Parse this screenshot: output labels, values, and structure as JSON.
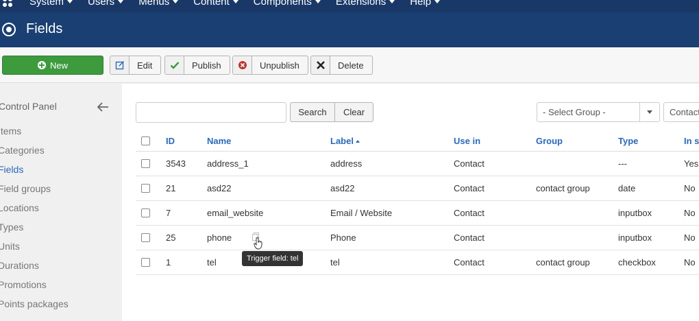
{
  "topnav": {
    "items": [
      {
        "label": "System"
      },
      {
        "label": "Users"
      },
      {
        "label": "Menus"
      },
      {
        "label": "Content"
      },
      {
        "label": "Components"
      },
      {
        "label": "Extensions"
      },
      {
        "label": "Help"
      }
    ]
  },
  "header": {
    "title": "Fields"
  },
  "toolbar": {
    "new_label": "New",
    "edit_label": "Edit",
    "publish_label": "Publish",
    "unpublish_label": "Unpublish",
    "delete_label": "Delete"
  },
  "sidebar": {
    "control_panel": "Control Panel",
    "items": [
      {
        "label": "Items",
        "active": false
      },
      {
        "label": "Categories",
        "active": false
      },
      {
        "label": "Fields",
        "active": true
      },
      {
        "label": "Field groups",
        "active": false
      },
      {
        "label": "Locations",
        "active": false
      },
      {
        "label": "Types",
        "active": false
      },
      {
        "label": "Units",
        "active": false
      },
      {
        "label": "Durations",
        "active": false
      },
      {
        "label": "Promotions",
        "active": false
      },
      {
        "label": "Points packages",
        "active": false
      }
    ]
  },
  "filters": {
    "search_value": "",
    "search_label": "Search",
    "clear_label": "Clear",
    "group_select": "- Select Group -",
    "context_select": "Contact"
  },
  "table": {
    "headers": {
      "id": "ID",
      "name": "Name",
      "label": "Label",
      "use_in": "Use in",
      "group": "Group",
      "type": "Type",
      "in_s": "In s"
    },
    "rows": [
      {
        "id": "3543",
        "name": "address_1",
        "label": "address",
        "use_in": "Contact",
        "group": "",
        "type": "---",
        "in_s": "Yes"
      },
      {
        "id": "21",
        "name": "asd22",
        "label": "asd22",
        "use_in": "Contact",
        "group": "contact group",
        "type": "date",
        "in_s": "No"
      },
      {
        "id": "7",
        "name": "email_website",
        "label": "Email / Website",
        "use_in": "Contact",
        "group": "",
        "type": "inputbox",
        "in_s": "No"
      },
      {
        "id": "25",
        "name": "phone",
        "label": "Phone",
        "use_in": "Contact",
        "group": "",
        "type": "inputbox",
        "in_s": "No"
      },
      {
        "id": "1",
        "name": "tel",
        "label": "tel",
        "use_in": "Contact",
        "group": "contact group",
        "type": "checkbox",
        "in_s": "No"
      }
    ]
  },
  "tooltip": {
    "text": "Trigger field: tel"
  },
  "colors": {
    "nav": "#1a3867",
    "header": "#1a3f72",
    "new_button": "#3d9a3d",
    "link": "#2a69b8"
  }
}
